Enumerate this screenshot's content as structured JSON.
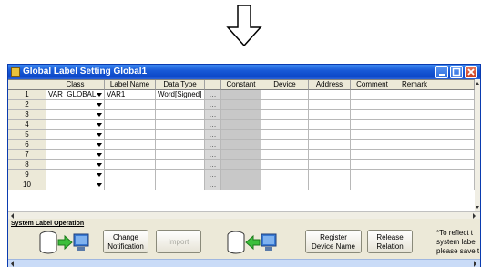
{
  "window": {
    "title": "Global Label Setting Global1",
    "accent": "#0d48c8"
  },
  "grid": {
    "columns": [
      "Class",
      "Label Name",
      "Data Type",
      "",
      "Constant",
      "Device",
      "Address",
      "Comment",
      "Remark"
    ],
    "rows": [
      {
        "num": "1",
        "class": "VAR_GLOBAL",
        "label": "VAR1",
        "type": "Word[Signed]"
      },
      {
        "num": "2",
        "class": "",
        "label": "",
        "type": ""
      },
      {
        "num": "3",
        "class": "",
        "label": "",
        "type": ""
      },
      {
        "num": "4",
        "class": "",
        "label": "",
        "type": ""
      },
      {
        "num": "5",
        "class": "",
        "label": "",
        "type": ""
      },
      {
        "num": "6",
        "class": "",
        "label": "",
        "type": ""
      },
      {
        "num": "7",
        "class": "",
        "label": "",
        "type": ""
      },
      {
        "num": "8",
        "class": "",
        "label": "",
        "type": ""
      },
      {
        "num": "9",
        "class": "",
        "label": "",
        "type": ""
      },
      {
        "num": "10",
        "class": "",
        "label": "",
        "type": ""
      }
    ]
  },
  "operation": {
    "label": "System Label Operation",
    "change_notification": "Change\nNotification",
    "import": "Import",
    "register_device_name": "Register\nDevice Name",
    "release_relation": "Release\nRelation",
    "note": "*To reflect t\nsystem label\nplease save t"
  }
}
